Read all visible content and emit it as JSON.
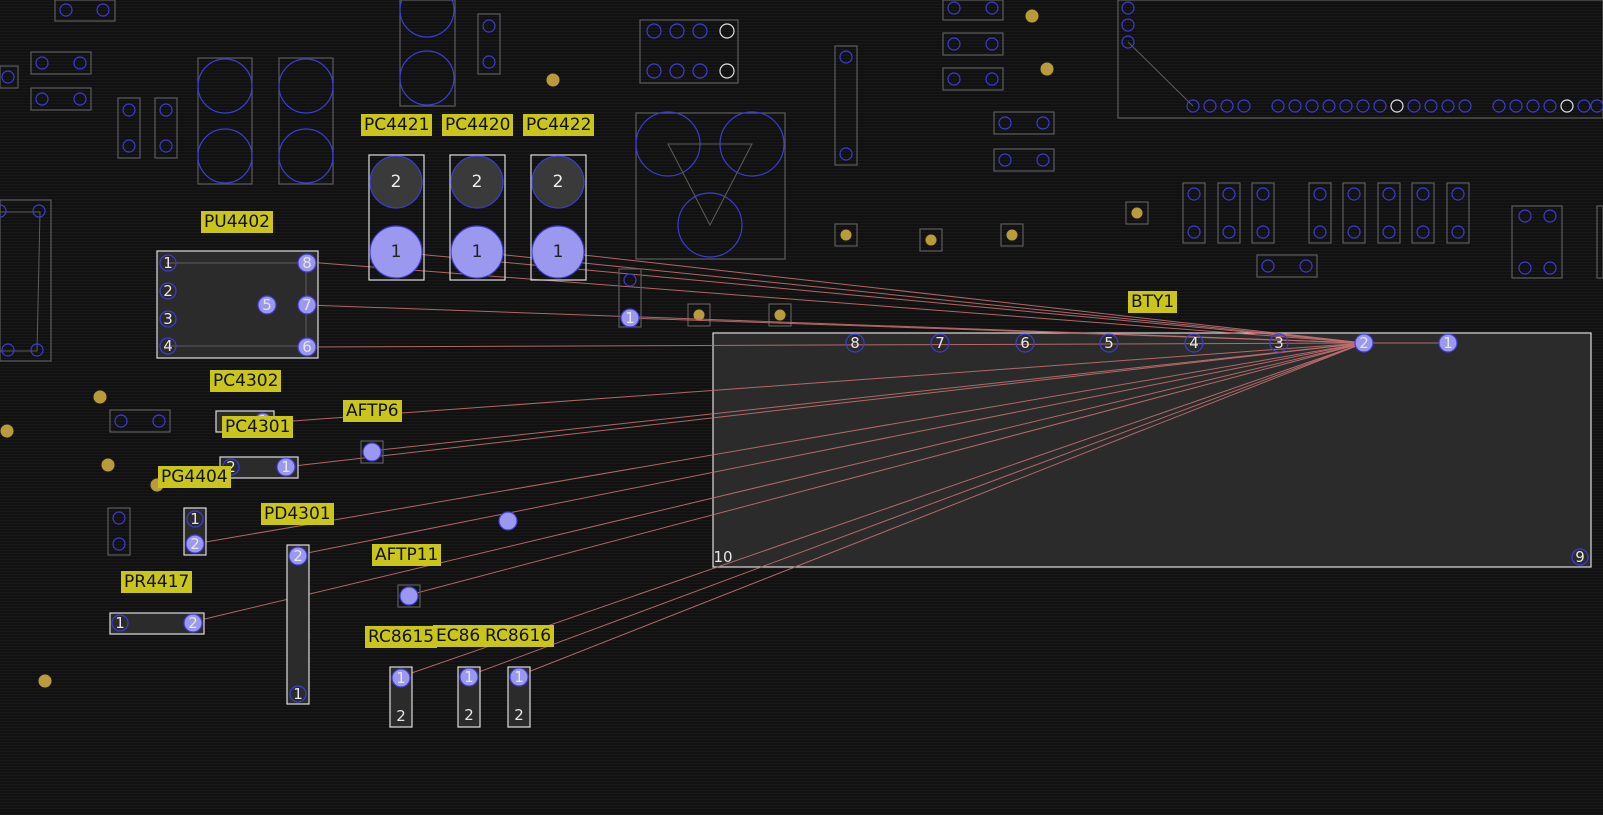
{
  "colors": {
    "background": "#111111",
    "outline_dim": "#5c5c5c",
    "outline_bright": "#dddddd",
    "pad_ring": "#3c3cd6",
    "pad_fill": "#9b98f0",
    "ratsnest": "#c07070",
    "via": "#b99b3a",
    "label_bg": "#c9c51a",
    "label_text": "#111111"
  },
  "reference_labels": {
    "PC4421": "PC4421",
    "PC4420": "PC4420",
    "PC4422": "PC4422",
    "PU4402": "PU4402",
    "PC4302": "PC4302",
    "PC4301": "PC4301",
    "AFTP6": "AFTP6",
    "PG4404": "PG4404",
    "PD4301": "PD4301",
    "AFTP11": "AFTP11",
    "PR4417": "PR4417",
    "RC8615": "RC8615",
    "EC86": "EC86",
    "RC8616": "RC8616",
    "BTY1": "BTY1"
  },
  "pins": {
    "bty1": [
      "8",
      "7",
      "6",
      "5",
      "4",
      "3",
      "2",
      "1",
      "10",
      "9"
    ],
    "pu4402": [
      "1",
      "2",
      "3",
      "4",
      "8",
      "5",
      "7",
      "6"
    ],
    "pc4421": [
      "2",
      "1"
    ],
    "pc4420": [
      "2",
      "1"
    ],
    "pc4422": [
      "2",
      "1"
    ],
    "pc4301": [
      "2",
      "1"
    ],
    "pg4404": [
      "1",
      "2"
    ],
    "pd4301": [
      "2",
      "1"
    ],
    "pr4417": [
      "1",
      "2"
    ],
    "rc8615": [
      "1",
      "2"
    ],
    "ec86": [
      "1",
      "2"
    ],
    "rc8616": [
      "1",
      "2"
    ],
    "small_part": [
      "1"
    ],
    "pc4302": [
      "1"
    ]
  }
}
